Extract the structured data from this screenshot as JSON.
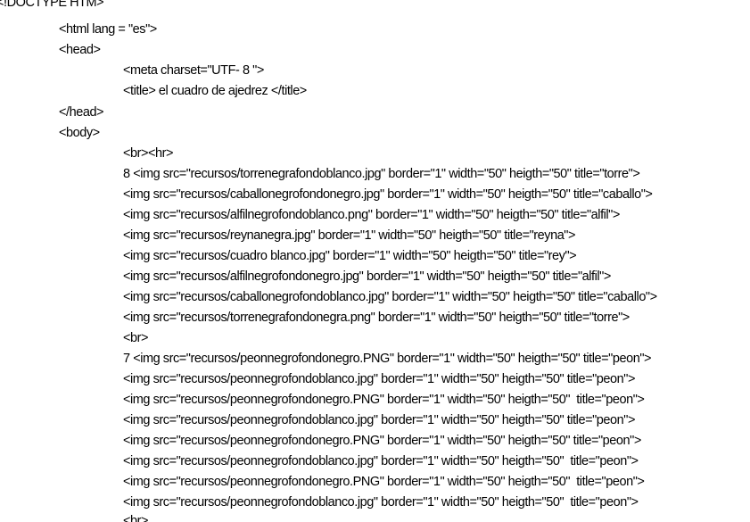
{
  "lines": [
    {
      "text": "<!DOCTYPE HTM>",
      "indent": 0
    },
    {
      "text": "<html lang = \"es\">",
      "indent": 1
    },
    {
      "text": "<head>",
      "indent": 1
    },
    {
      "text": "<meta charset=\"UTF- 8 \">",
      "indent": 2
    },
    {
      "text": "<title> el cuadro de ajedrez </title>",
      "indent": 2
    },
    {
      "text": "</head>",
      "indent": 1
    },
    {
      "text": "<body>",
      "indent": 1
    },
    {
      "text": "<br><hr>",
      "indent": 2
    },
    {
      "text": "8 <img src=\"recursos/torrenegrafondoblanco.jpg\" border=\"1\" width=\"50\" heigth=\"50\" title=\"torre\">",
      "indent": 2
    },
    {
      "text": "<img src=\"recursos/caballonegrofondonegro.jpg\" border=\"1\" width=\"50\" heigth=\"50\" title=\"caballo\">",
      "indent": 2
    },
    {
      "text": "<img src=\"recursos/alfilnegrofondoblanco.png\" border=\"1\" width=\"50\" heigth=\"50\" title=\"alfil\">",
      "indent": 2
    },
    {
      "text": "<img src=\"recursos/reynanegra.jpg\" border=\"1\" width=\"50\" heigth=\"50\" title=\"reyna\">",
      "indent": 2
    },
    {
      "text": "<img src=\"recursos/cuadro blanco.jpg\" border=\"1\" width=\"50\" heigth=\"50\" title=\"rey\">",
      "indent": 2
    },
    {
      "text": "<img src=\"recursos/alfilnegrofondonegro.jpg\" border=\"1\" width=\"50\" heigth=\"50\" title=\"alfil\">",
      "indent": 2
    },
    {
      "text": "<img src=\"recursos/caballonegrofondoblanco.jpg\" border=\"1\" width=\"50\" heigth=\"50\" title=\"caballo\">",
      "indent": 2
    },
    {
      "text": "<img src=\"recursos/torrenegrafondonegra.png\" border=\"1\" width=\"50\" heigth=\"50\" title=\"torre\">",
      "indent": 2
    },
    {
      "text": "<br>",
      "indent": 2
    },
    {
      "text": "7 <img src=\"recursos/peonnegrofondonegro.PNG\" border=\"1\" width=\"50\" heigth=\"50\" title=\"peon\">",
      "indent": 2
    },
    {
      "text": "<img src=\"recursos/peonnegrofondoblanco.jpg\" border=\"1\" width=\"50\" heigth=\"50\" title=\"peon\">",
      "indent": 2
    },
    {
      "text": "<img src=\"recursos/peonnegrofondonegro.PNG\" border=\"1\" width=\"50\" heigth=\"50\"  title=\"peon\">",
      "indent": 2
    },
    {
      "text": "<img src=\"recursos/peonnegrofondoblanco.jpg\" border=\"1\" width=\"50\" heigth=\"50\" title=\"peon\">",
      "indent": 2
    },
    {
      "text": "<img src=\"recursos/peonnegrofondonegro.PNG\" border=\"1\" width=\"50\" heigth=\"50\" title=\"peon\">",
      "indent": 2
    },
    {
      "text": "<img src=\"recursos/peonnegrofondoblanco.jpg\" border=\"1\" width=\"50\" heigth=\"50\"  title=\"peon\">",
      "indent": 2
    },
    {
      "text": "<img src=\"recursos/peonnegrofondonegro.PNG\" border=\"1\" width=\"50\" heigth=\"50\"  title=\"peon\">",
      "indent": 2
    },
    {
      "text": "<img src=\"recursos/peonnegrofondoblanco.jpg\" border=\"1\" width=\"50\" heigth=\"50\"  title=\"peon\">",
      "indent": 2
    },
    {
      "text": "<br>",
      "indent": 2
    }
  ]
}
